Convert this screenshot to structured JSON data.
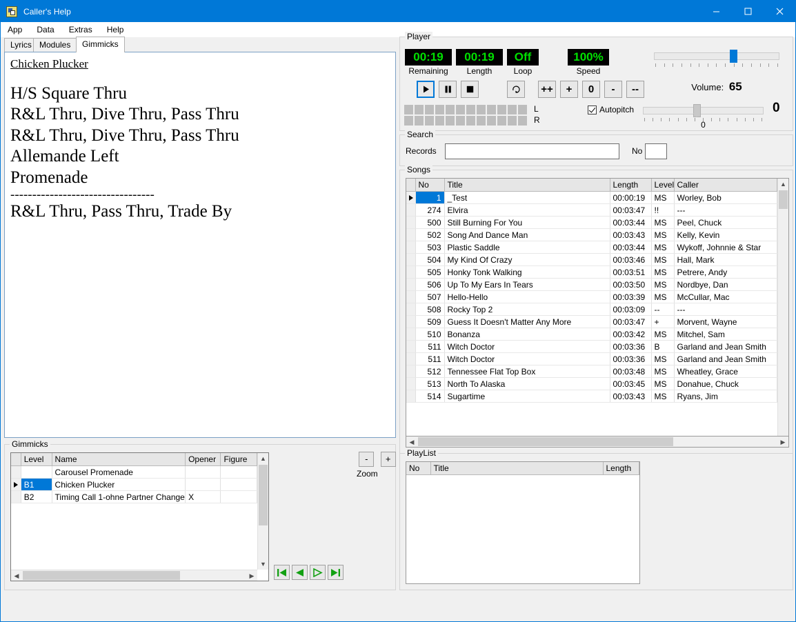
{
  "window": {
    "title": "Caller's Help",
    "icon": "app-icon",
    "controls": {
      "minimize": "–",
      "maximize": "□",
      "close": "✕"
    }
  },
  "menubar": {
    "items": [
      "App",
      "Data",
      "Extras",
      "Help"
    ]
  },
  "tabs": {
    "items": [
      {
        "label": "Lyrics",
        "active": false
      },
      {
        "label": "Modules",
        "active": false
      },
      {
        "label": "Gimmicks",
        "active": true
      }
    ]
  },
  "lyrics": {
    "title": "Chicken Plucker",
    "lines": [
      "H/S Square Thru",
      "R&L Thru, Dive Thru, Pass Thru",
      "R&L Thru, Dive Thru, Pass Thru",
      "Allemande Left",
      "Promenade"
    ],
    "separator": "---------------------------------",
    "lines2": [
      "R&L Thru, Pass Thru, Trade By"
    ]
  },
  "player": {
    "legend": "Player",
    "displays": [
      {
        "value": "00:19",
        "caption": "Remaining"
      },
      {
        "value": "00:19",
        "caption": "Length"
      },
      {
        "value": "Off",
        "caption": "Loop"
      },
      {
        "value": "100%",
        "caption": "Speed"
      }
    ],
    "transport": [
      {
        "name": "play",
        "glyph": "▶",
        "active": true
      },
      {
        "name": "pause",
        "glyph": "❙❙",
        "active": false
      },
      {
        "name": "stop",
        "glyph": "■",
        "active": false
      }
    ],
    "loop_button": "↻",
    "speed_buttons": [
      "++",
      "+",
      "0",
      "-",
      "--"
    ],
    "vu": {
      "segments": 12,
      "labels": [
        "L",
        "R"
      ]
    },
    "autopitch": {
      "label": "Autopitch",
      "checked": true
    },
    "volume": {
      "label": "Volume:",
      "value": "65",
      "percent": 65
    },
    "pitch": {
      "value": "0",
      "center_label": "0",
      "percent": 41
    },
    "led_color": "#00e000",
    "led_bg": "#000000",
    "accent": "#0078d7"
  },
  "search": {
    "legend": "Search",
    "records_label": "Records",
    "records_value": "",
    "no_label": "No",
    "no_value": ""
  },
  "songs": {
    "legend": "Songs",
    "columns": [
      "No",
      "Title",
      "Length",
      "Level",
      "Caller"
    ],
    "selected_index": 0,
    "rows": [
      {
        "no": "1",
        "title": "_Test",
        "length": "00:00:19",
        "level": "MS",
        "caller": "Worley, Bob"
      },
      {
        "no": "274",
        "title": "Elvira",
        "length": "00:03:47",
        "level": "!!",
        "caller": "---"
      },
      {
        "no": "500",
        "title": "Still Burning For You",
        "length": "00:03:44",
        "level": "MS",
        "caller": "Peel, Chuck"
      },
      {
        "no": "502",
        "title": "Song And Dance Man",
        "length": "00:03:43",
        "level": "MS",
        "caller": "Kelly, Kevin"
      },
      {
        "no": "503",
        "title": "Plastic Saddle",
        "length": "00:03:44",
        "level": "MS",
        "caller": "Wykoff, Johnnie & Star"
      },
      {
        "no": "504",
        "title": "My Kind Of Crazy",
        "length": "00:03:46",
        "level": "MS",
        "caller": "Hall, Mark"
      },
      {
        "no": "505",
        "title": "Honky Tonk Walking",
        "length": "00:03:51",
        "level": "MS",
        "caller": "Petrere, Andy"
      },
      {
        "no": "506",
        "title": "Up To My Ears In Tears",
        "length": "00:03:50",
        "level": "MS",
        "caller": "Nordbye, Dan"
      },
      {
        "no": "507",
        "title": "Hello-Hello",
        "length": "00:03:39",
        "level": "MS",
        "caller": "McCullar, Mac"
      },
      {
        "no": "508",
        "title": "Rocky Top 2",
        "length": "00:03:09",
        "level": "--",
        "caller": "---"
      },
      {
        "no": "509",
        "title": "Guess It Doesn't Matter Any More",
        "length": "00:03:47",
        "level": "+",
        "caller": "Morvent, Wayne"
      },
      {
        "no": "510",
        "title": "Bonanza",
        "length": "00:03:42",
        "level": "MS",
        "caller": "Mitchel, Sam"
      },
      {
        "no": "511",
        "title": "Witch Doctor",
        "length": "00:03:36",
        "level": "B",
        "caller": "Garland and Jean Smith"
      },
      {
        "no": "511",
        "title": "Witch Doctor",
        "length": "00:03:36",
        "level": "MS",
        "caller": "Garland and Jean Smith"
      },
      {
        "no": "512",
        "title": "Tennessee Flat Top Box",
        "length": "00:03:48",
        "level": "MS",
        "caller": "Wheatley, Grace"
      },
      {
        "no": "513",
        "title": "North To Alaska",
        "length": "00:03:45",
        "level": "MS",
        "caller": "Donahue, Chuck"
      },
      {
        "no": "514",
        "title": "Sugartime",
        "length": "00:03:43",
        "level": "MS",
        "caller": "Ryans, Jim"
      }
    ]
  },
  "gimmicks": {
    "legend": "Gimmicks",
    "columns": [
      "Level",
      "Name",
      "Opener",
      "Figure"
    ],
    "selected_index": 1,
    "rows": [
      {
        "level": "",
        "name": "Carousel Promenade",
        "opener": "",
        "figure": ""
      },
      {
        "level": "B1",
        "name": "Chicken Plucker",
        "opener": "",
        "figure": ""
      },
      {
        "level": "B2",
        "name": "Timing Call 1-ohne Partner Change",
        "opener": "X",
        "figure": ""
      }
    ],
    "zoom": {
      "minus": "-",
      "plus": "+",
      "label": "Zoom"
    },
    "nav": [
      "first",
      "previous",
      "next",
      "last"
    ]
  },
  "playlist": {
    "legend": "PlayList",
    "columns": [
      "No",
      "Title",
      "Length"
    ],
    "rows": []
  }
}
